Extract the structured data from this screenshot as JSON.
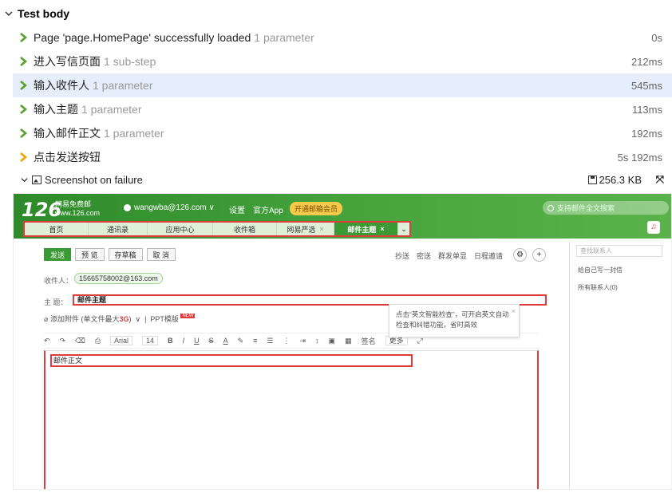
{
  "section": {
    "title": "Test body"
  },
  "steps": [
    {
      "name": "Page 'page.HomePage' successfully loaded",
      "param": "1 parameter",
      "duration": "0s"
    },
    {
      "name": "进入写信页面",
      "param": "1 sub-step",
      "duration": "212ms"
    },
    {
      "name": "输入收件人",
      "param": "1 parameter",
      "duration": "545ms"
    },
    {
      "name": "输入主题",
      "param": "1 parameter",
      "duration": "113ms"
    },
    {
      "name": "输入邮件正文",
      "param": "1 parameter",
      "duration": "192ms"
    },
    {
      "name": "点击发送按钮",
      "param": "",
      "duration": "5s 192ms"
    }
  ],
  "attachment": {
    "name": "Screenshot on failure",
    "size": "256.3 KB"
  },
  "colors": {
    "accent_green": "#3c9a35",
    "highlight_red": "#e03b3b",
    "step_arrow_green": "#5aa02c",
    "step_arrow_orange": "#f0a000",
    "selected_row": "#e6eefc"
  },
  "mail": {
    "logo": "126",
    "logo_sub1": "网易免费邮",
    "logo_sub2": "www.126.com",
    "user": "wangwba@126.com ∨",
    "links": [
      "设置",
      "官方App"
    ],
    "vip": "开通邮箱会员",
    "search_placeholder": "支持邮件全文搜索",
    "tabs": [
      {
        "label": "首页"
      },
      {
        "label": "通讯录"
      },
      {
        "label": "应用中心"
      },
      {
        "label": "收件箱"
      },
      {
        "label": "网易严选"
      },
      {
        "label": "邮件主题"
      }
    ],
    "buttons": {
      "send": "发送",
      "preview": "预 览",
      "draft": "存草稿",
      "cancel": "取 消"
    },
    "right_links": [
      "抄送",
      "密送",
      "群发单显",
      "日程邀请"
    ],
    "to_label": "收件人：",
    "recipient": "15665758002@163.com",
    "subject_label": "主 题：",
    "subject": "邮件主题",
    "add_attachment": "添加附件",
    "attach_note_prefix": "(单文件最大",
    "attach_note_big": "3G",
    "attach_note_suffix": ")",
    "ppt": "PPT模版",
    "new_badge": "NEW",
    "font": "Arial",
    "size": "14",
    "signature": "签名",
    "more": "更多",
    "body": "邮件正文",
    "tip": "点击“英文智能检查”，可开启英文自动检查和纠错功能，省时高效",
    "contact_search": "查找联系人",
    "write_self": "给自己写一封信",
    "all_contacts": "所有联系人(0)"
  }
}
